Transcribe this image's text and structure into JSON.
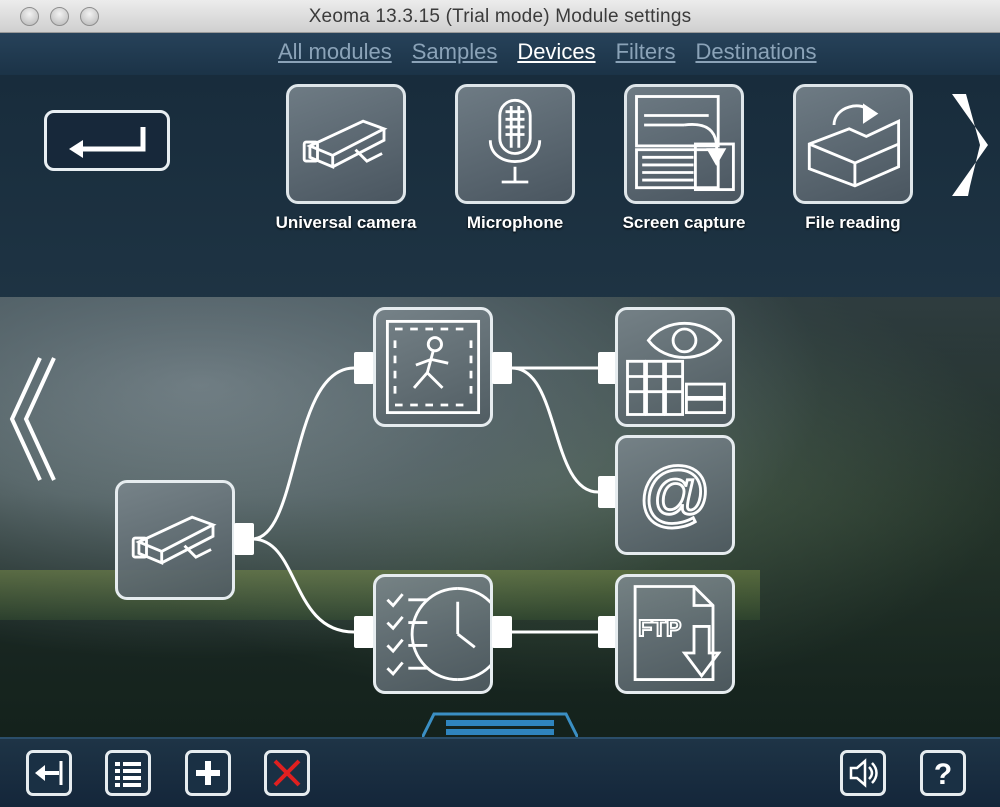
{
  "window": {
    "title": "Xeoma 13.3.15 (Trial mode) Module settings"
  },
  "tabs": [
    {
      "label": "All modules",
      "active": false
    },
    {
      "label": "Samples",
      "active": false
    },
    {
      "label": "Devices",
      "active": true
    },
    {
      "label": "Filters",
      "active": false
    },
    {
      "label": "Destinations",
      "active": false
    }
  ],
  "device_modules": [
    {
      "label": "Universal camera",
      "icon": "camera-icon"
    },
    {
      "label": "Microphone",
      "icon": "microphone-icon"
    },
    {
      "label": "Screen capture",
      "icon": "screen-capture-icon"
    },
    {
      "label": "File reading",
      "icon": "file-reading-icon"
    }
  ],
  "workspace_modules": [
    {
      "icon": "camera-icon"
    },
    {
      "icon": "motion-detector-icon"
    },
    {
      "icon": "preview-archive-icon"
    },
    {
      "icon": "email-icon",
      "text": "@"
    },
    {
      "icon": "scheduler-icon"
    },
    {
      "icon": "ftp-upload-icon",
      "text": "FTP"
    }
  ],
  "toolbar": {
    "buttons": [
      "exit-icon",
      "list-icon",
      "add-icon",
      "delete-icon",
      "sound-icon",
      "help-icon"
    ],
    "help_text": "?"
  },
  "colors": {
    "accent": "#ffffff",
    "panel": "#1d2c38",
    "delete": "#e02020"
  }
}
